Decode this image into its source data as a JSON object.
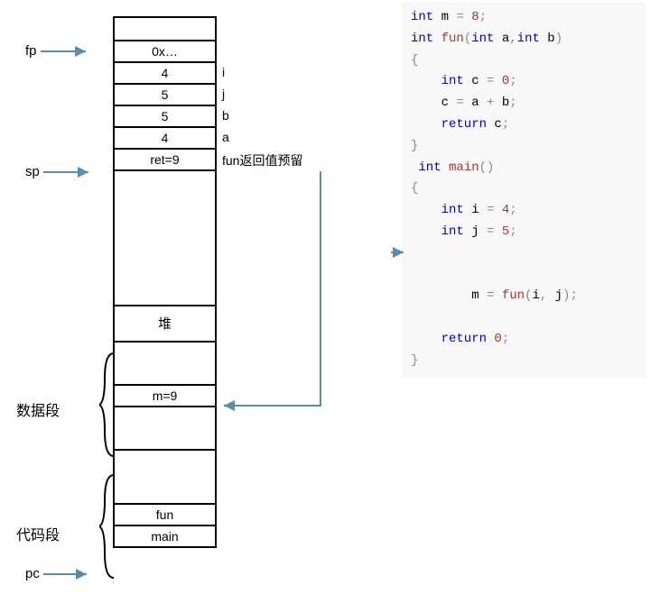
{
  "labels": {
    "fp": "fp",
    "sp": "sp",
    "dataSeg": "数据段",
    "codeSeg": "代码段",
    "pc": "pc"
  },
  "stack": {
    "fpCell": "0x…",
    "i": "4",
    "j": "5",
    "b": "5",
    "a": "4",
    "ret": "ret=9",
    "iLabel": "i",
    "jLabel": "j",
    "bLabel": "b",
    "aLabel": "a",
    "retLabel": "fun返回值预留",
    "heap": "堆",
    "m": "m=9",
    "fun": "fun",
    "main": "main"
  },
  "code": {
    "l1_a": "int",
    "l1_b": " m ",
    "l1_c": "=",
    "l1_d": " 8",
    "l1_e": ";",
    "l2_a": "int",
    "l2_b": " fun",
    "l2_c": "(",
    "l2_d": "int",
    "l2_e": " a",
    "l2_f": ",",
    "l2_g": "int",
    "l2_h": " b",
    "l2_i": ")",
    "l3": "{",
    "l4_a": "    int",
    "l4_b": " c ",
    "l4_c": "=",
    "l4_d": " 0",
    "l4_e": ";",
    "l5_a": "    c ",
    "l5_b": "=",
    "l5_c": " a ",
    "l5_d": "+",
    "l5_e": " b",
    "l5_f": ";",
    "l6_a": "    return",
    "l6_b": " c",
    "l6_c": ";",
    "l7": "}",
    "l8_a": " int",
    "l8_b": " main",
    "l8_c": "()",
    "l9": "{",
    "l10_a": "    int",
    "l10_b": " i ",
    "l10_c": "=",
    "l10_d": " 4",
    "l10_e": ";",
    "l11_a": "    int",
    "l11_b": " j ",
    "l11_c": "=",
    "l11_d": " 5",
    "l11_e": ";",
    "l12_a": "    m ",
    "l12_b": "=",
    "l12_c": " fun",
    "l12_d": "(",
    "l12_e": "i",
    "l12_f": ",",
    "l12_g": " j",
    "l12_h": ")",
    "l12_i": ";",
    "l13_a": "    return",
    "l13_b": " 0",
    "l13_c": ";",
    "l14": "}"
  }
}
